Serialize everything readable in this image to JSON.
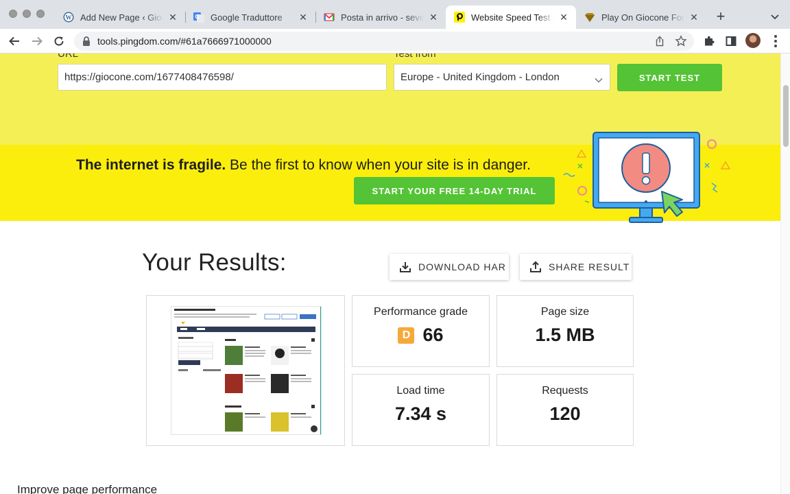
{
  "browser": {
    "tabs": [
      {
        "title": "Add New Page ‹ Giocone — WordPress",
        "active": false
      },
      {
        "title": "Google Traduttore",
        "active": false
      },
      {
        "title": "Posta in arrivo - seven",
        "active": false
      },
      {
        "title": "Website Speed Test | Pingdom",
        "active": true
      },
      {
        "title": "Play On Giocone For Free",
        "active": false
      }
    ],
    "url": "tools.pingdom.com/#61a7666971000000"
  },
  "form": {
    "url_label": "URL",
    "url_value": "https://giocone.com/1677408476598/",
    "test_from_label": "Test from",
    "test_from_value": "Europe - United Kingdom - London",
    "start_test_label": "START TEST"
  },
  "banner": {
    "headline_bold": "The internet is fragile.",
    "headline_rest": " Be the first to know when your site is in danger.",
    "cta_label": "START YOUR FREE 14-DAY TRIAL"
  },
  "results": {
    "title": "Your Results:",
    "download_har_label": "DOWNLOAD HAR",
    "share_result_label": "SHARE RESULT",
    "metrics": {
      "performance_grade": {
        "label": "Performance grade",
        "grade": "D",
        "value": "66"
      },
      "page_size": {
        "label": "Page size",
        "value": "1.5 MB"
      },
      "load_time": {
        "label": "Load time",
        "value": "7.34 s"
      },
      "requests": {
        "label": "Requests",
        "value": "120"
      }
    }
  },
  "improve_heading": "Improve page performance",
  "colors": {
    "hero_bg": "#f5ef56",
    "banner_bg": "#fbee0c",
    "green": "#54c335",
    "grade_orange": "#f6a93b"
  }
}
